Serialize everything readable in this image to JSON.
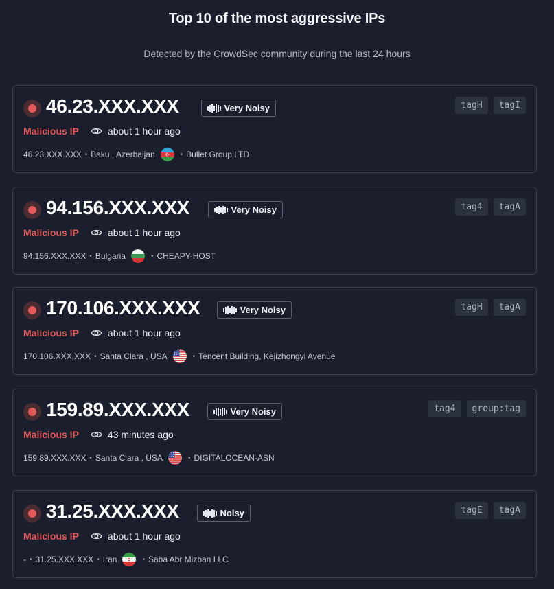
{
  "header": {
    "title": "Top 10 of the most aggressive IPs",
    "subtitle": "Detected by the CrowdSec community during the last 24 hours"
  },
  "colors": {
    "background": "#1b1f2d",
    "malicious": "#e2595a",
    "card_border": "#3a4050",
    "tag_bg": "#2c3140"
  },
  "cards": [
    {
      "ip": "46.23.XXX.XXX",
      "noise": "Very Noisy",
      "status": "Malicious IP",
      "seen": "about 1 hour ago",
      "meta_prefix": "",
      "meta_ip": "46.23.XXX.XXX",
      "location": "Baku , Azerbaijan",
      "flag": "azerbaijan-flag-icon",
      "asn": "Bullet Group LTD",
      "tags": [
        "tagH",
        "tagI"
      ]
    },
    {
      "ip": "94.156.XXX.XXX",
      "noise": "Very Noisy",
      "status": "Malicious IP",
      "seen": "about 1 hour ago",
      "meta_prefix": "",
      "meta_ip": "94.156.XXX.XXX",
      "location": "Bulgaria",
      "flag": "bulgaria-flag-icon",
      "asn": "CHEAPY-HOST",
      "tags": [
        "tag4",
        "tagA"
      ]
    },
    {
      "ip": "170.106.XXX.XXX",
      "noise": "Very Noisy",
      "status": "Malicious IP",
      "seen": "about 1 hour ago",
      "meta_prefix": "",
      "meta_ip": "170.106.XXX.XXX",
      "location": "Santa Clara , USA",
      "flag": "usa-flag-icon",
      "asn": "Tencent Building, Kejizhongyi Avenue",
      "tags": [
        "tagH",
        "tagA"
      ]
    },
    {
      "ip": "159.89.XXX.XXX",
      "noise": "Very Noisy",
      "status": "Malicious IP",
      "seen": "43 minutes ago",
      "meta_prefix": "",
      "meta_ip": "159.89.XXX.XXX",
      "location": "Santa Clara , USA",
      "flag": "usa-flag-icon",
      "asn": "DIGITALOCEAN-ASN",
      "tags": [
        "tag4",
        "group:tag"
      ]
    },
    {
      "ip": "31.25.XXX.XXX",
      "noise": "Noisy",
      "status": "Malicious IP",
      "seen": "about 1 hour ago",
      "meta_prefix": "-",
      "meta_ip": "31.25.XXX.XXX",
      "location": "Iran",
      "flag": "iran-flag-icon",
      "asn": "Saba Abr Mizban LLC",
      "tags": [
        "tagE",
        "tagA"
      ]
    }
  ]
}
